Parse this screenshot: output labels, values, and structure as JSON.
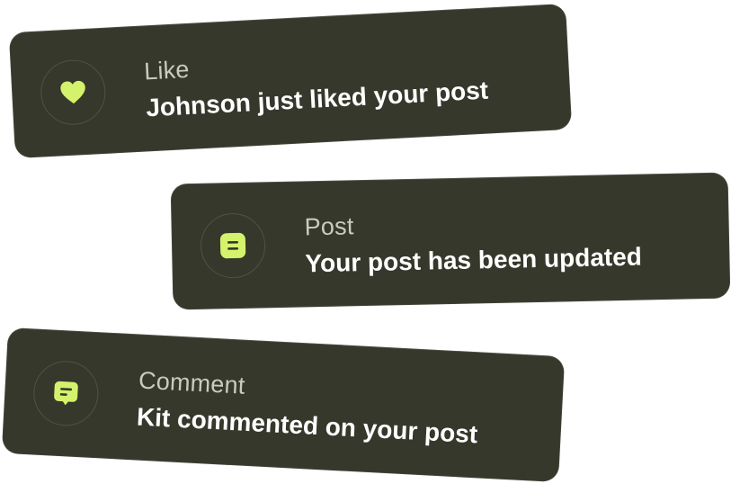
{
  "colors": {
    "card_background": "#36382b",
    "accent": "#d4f26c",
    "title_text": "#c9cbbd",
    "message_text": "#ffffff"
  },
  "notifications": [
    {
      "type": "like",
      "icon": "heart-icon",
      "title": "Like",
      "message": "Johnson just liked your post"
    },
    {
      "type": "post",
      "icon": "post-document-icon",
      "title": "Post",
      "message": "Your post has been updated"
    },
    {
      "type": "comment",
      "icon": "comment-bubble-icon",
      "title": "Comment",
      "message": "Kit commented on your post"
    }
  ]
}
